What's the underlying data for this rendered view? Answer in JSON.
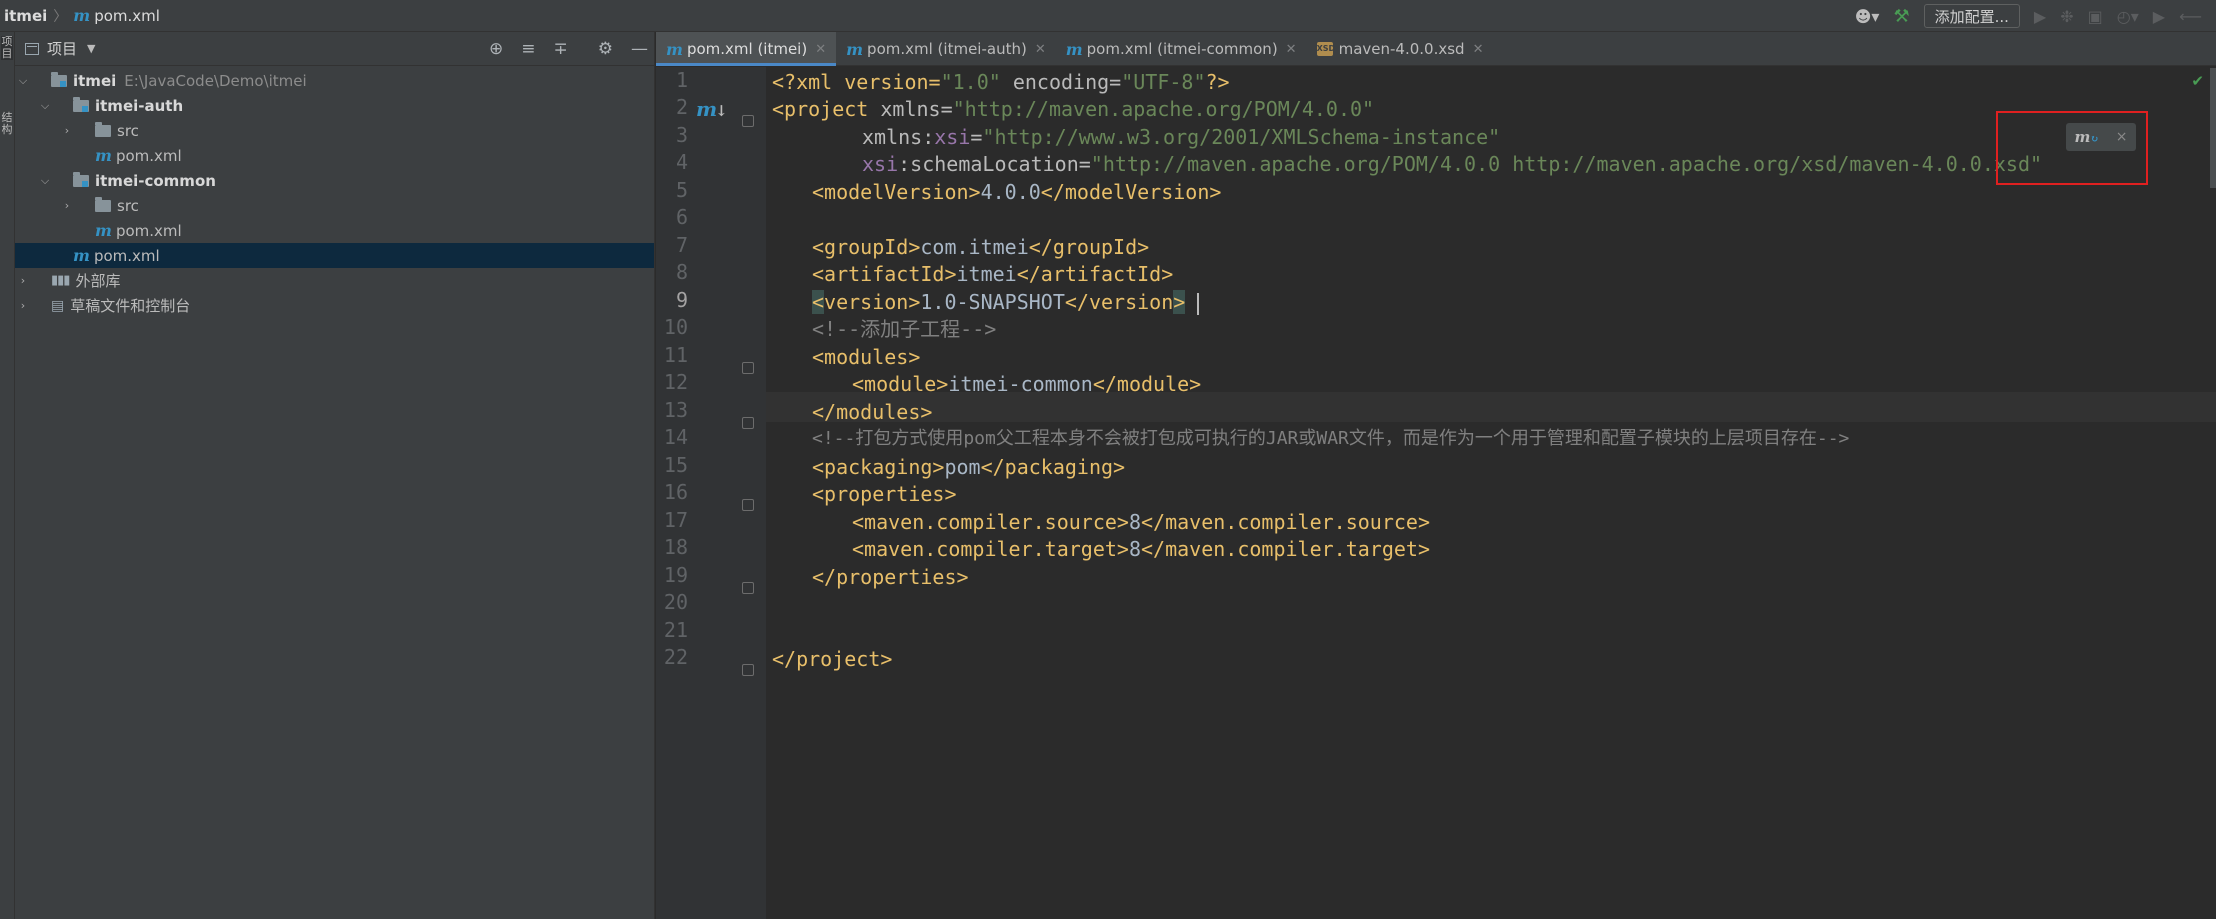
{
  "titlebar": {
    "project": "itmei",
    "separator": "〉",
    "file_icon": "m",
    "file": "pom.xml",
    "add_config_label": "添加配置..."
  },
  "left_strip": {
    "items": [
      "项目",
      "结构"
    ]
  },
  "project_panel": {
    "title": "项目",
    "tree": [
      {
        "label": "itmei",
        "path": "E:\\JavaCode\\Demo\\itmei"
      },
      {
        "label": "itmei-auth"
      },
      {
        "label": "src"
      },
      {
        "label": "pom.xml",
        "icon": "m"
      },
      {
        "label": "itmei-common"
      },
      {
        "label": "src"
      },
      {
        "label": "pom.xml",
        "icon": "m"
      },
      {
        "label": "pom.xml",
        "icon": "m"
      },
      {
        "label": "外部库"
      },
      {
        "label": "草稿文件和控制台"
      }
    ]
  },
  "tabs": [
    {
      "label": "pom.xml (itmei)",
      "icon": "m",
      "active": true
    },
    {
      "label": "pom.xml (itmei-auth)",
      "icon": "m"
    },
    {
      "label": "pom.xml (itmei-common)",
      "icon": "m"
    },
    {
      "label": "maven-4.0.0.xsd",
      "icon": "XSD"
    }
  ],
  "editor": {
    "line_numbers": [
      "1",
      "2",
      "3",
      "4",
      "5",
      "6",
      "7",
      "8",
      "9",
      "10",
      "11",
      "12",
      "13",
      "14",
      "15",
      "16",
      "17",
      "18",
      "19",
      "20",
      "21",
      "22"
    ],
    "current_line": 9,
    "lines": {
      "l1": {
        "a": "<?xml version=",
        "b": "\"1.0\"",
        "c": " encoding=",
        "d": "\"UTF-8\"",
        "e": "?>"
      },
      "l2": {
        "a": "<project ",
        "b": "xmlns=",
        "c": "\"http://maven.apache.org/POM/4.0.0\""
      },
      "l3": {
        "a": "xmlns:",
        "b": "xsi",
        "c": "=",
        "d": "\"http://www.w3.org/2001/XMLSchema-instance\""
      },
      "l4": {
        "a": "xsi",
        "b": ":schemaLocation=",
        "c": "\"http://maven.apache.org/POM/4.0.0 http://maven.apache.org/xsd/maven-4.0.0.xsd\""
      },
      "l5": {
        "a": "<modelVersion>",
        "b": "4.0.0",
        "c": "</modelVersion>"
      },
      "l7": {
        "a": "<groupId>",
        "b": "com.itmei",
        "c": "</groupId>"
      },
      "l8": {
        "a": "<artifactId>",
        "b": "itmei",
        "c": "</artifactId>"
      },
      "l9": {
        "a": "<",
        "b": "version>",
        "c": "1.0-SNAPSHOT",
        "d": "</version",
        ">": ">"
      },
      "l10": {
        "a": "<!--添加子工程-->"
      },
      "l11": {
        "a": "<modules>"
      },
      "l12": {
        "a": "<module>",
        "b": "itmei-common",
        "c": "</module>"
      },
      "l13": {
        "a": "</modules>"
      },
      "l14": {
        "a": "<!--打包方式使用pom父工程本身不会被打包成可执行的JAR或WAR文件，而是作为一个用于管理和配置子模块的上层项目存在-->"
      },
      "l15": {
        "a": "<packaging>",
        "b": "pom",
        "c": "</packaging>"
      },
      "l16": {
        "a": "<properties>"
      },
      "l17": {
        "a": "<maven.compiler.source>",
        "b": "8",
        "c": "</maven.compiler.source>"
      },
      "l18": {
        "a": "<maven.compiler.target>",
        "b": "8",
        "c": "</maven.compiler.target>"
      },
      "l19": {
        "a": "</properties>"
      },
      "l22": {
        "a": "</project>"
      }
    }
  },
  "maven_popup": {
    "icon": "m",
    "close": "×"
  },
  "colors": {
    "tag": "#e8bf6a",
    "string": "#6a8759",
    "namespace": "#9876aa",
    "comment": "#808080",
    "selection": "#0d293e",
    "accent": "#4a88c7",
    "highlight_box": "#e02020"
  }
}
